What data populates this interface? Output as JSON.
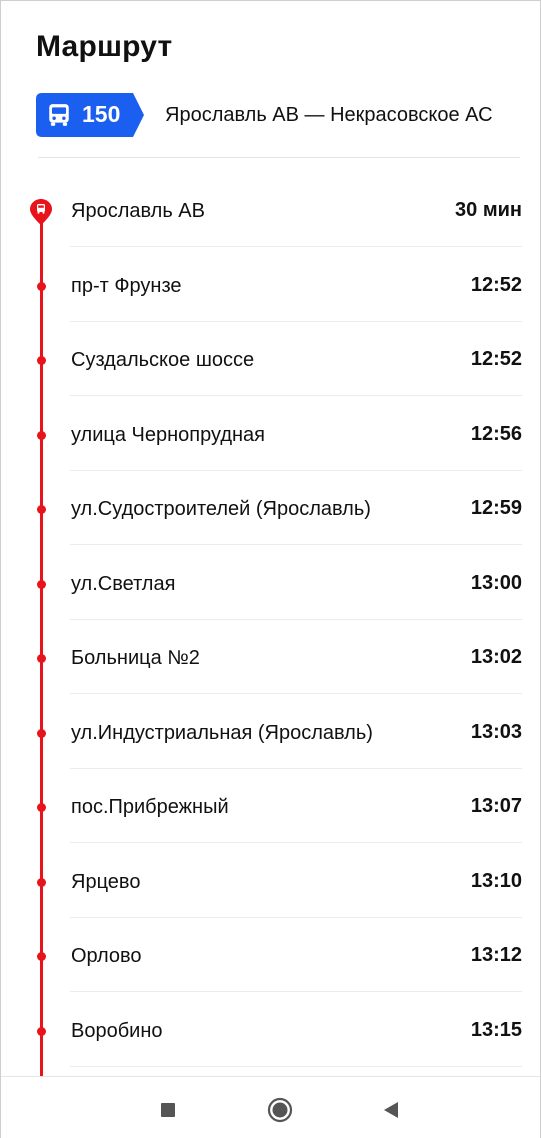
{
  "header": {
    "title": "Маршрут"
  },
  "route": {
    "number": "150",
    "name": "Ярославль АВ — Некрасовское АС",
    "badge_color": "#1a5ff0",
    "line_color": "#e8141c"
  },
  "stops": [
    {
      "name": "Ярославль АВ",
      "time": "30 мин"
    },
    {
      "name": "пр-т  Фрунзе",
      "time": "12:52"
    },
    {
      "name": "Суздальское шоссе",
      "time": "12:52"
    },
    {
      "name": "улица Чернопрудная",
      "time": "12:56"
    },
    {
      "name": "ул.Судостроителей (Ярославль)",
      "time": "12:59"
    },
    {
      "name": "ул.Светлая",
      "time": "13:00"
    },
    {
      "name": "Больница №2",
      "time": "13:02"
    },
    {
      "name": "ул.Индустриальная (Ярославль)",
      "time": "13:03"
    },
    {
      "name": "пос.Прибрежный",
      "time": "13:07"
    },
    {
      "name": "Ярцево",
      "time": "13:10"
    },
    {
      "name": "Орлово",
      "time": "13:12"
    },
    {
      "name": "Воробино",
      "time": "13:15"
    }
  ],
  "navbar": {
    "icons": [
      "recents-square-icon",
      "home-circle-icon",
      "back-triangle-icon"
    ]
  }
}
